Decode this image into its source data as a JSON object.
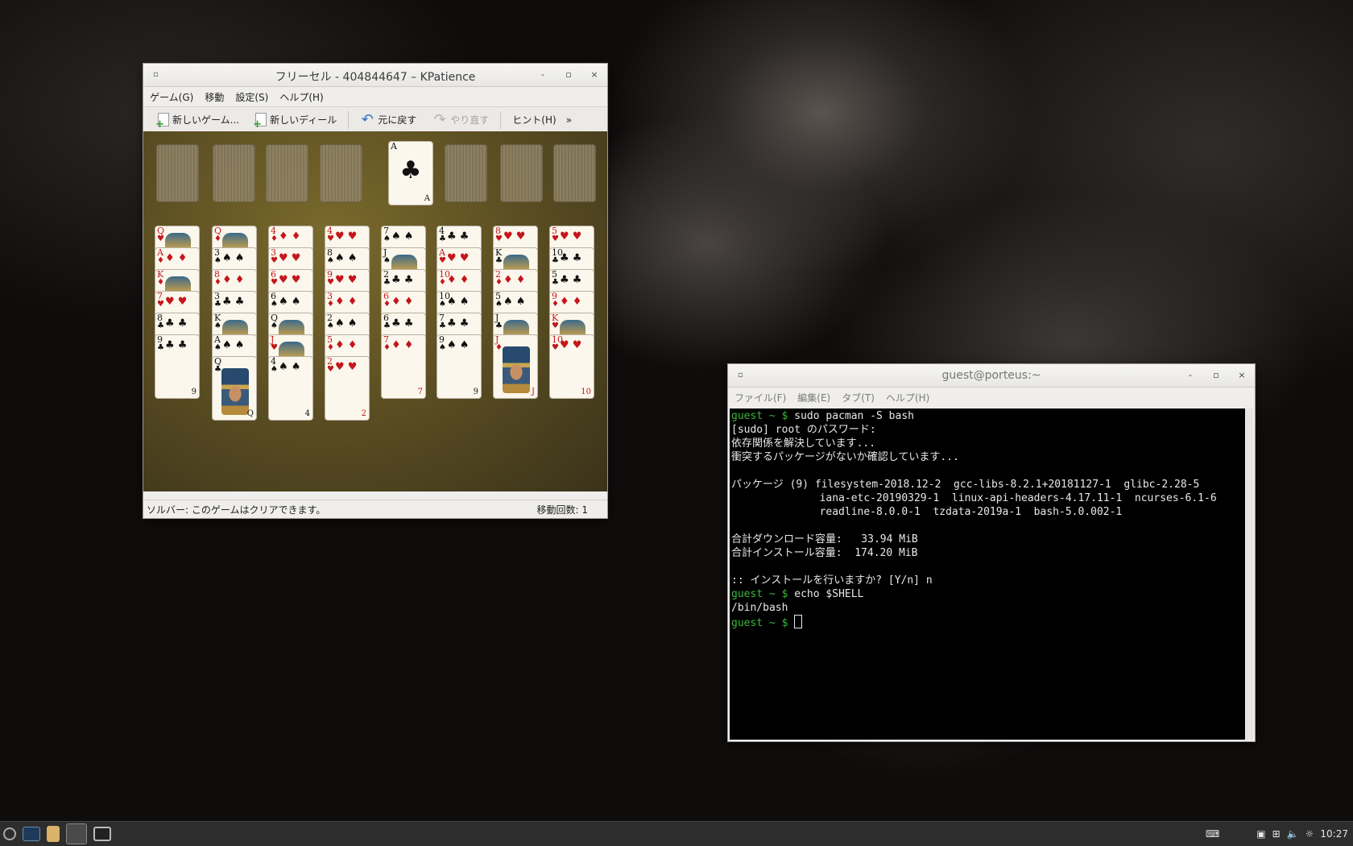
{
  "kpatience": {
    "title": "フリーセル - 404844647 – KPatience",
    "menu": [
      "ゲーム(G)",
      "移動",
      "設定(S)",
      "ヘルプ(H)"
    ],
    "toolbar": {
      "new_game": "新しいゲーム...",
      "new_deal": "新しいディール",
      "undo": "元に戻す",
      "redo": "やり直す",
      "hint": "ヒント(H)",
      "more": "»"
    },
    "foundation_card": {
      "rank": "A",
      "suit": "♣",
      "color": "black"
    },
    "columns": [
      [
        {
          "r": "Q",
          "s": "♥",
          "c": "red",
          "f": 1
        },
        {
          "r": "A",
          "s": "♦",
          "c": "red"
        },
        {
          "r": "K",
          "s": "♦",
          "c": "red",
          "f": 1
        },
        {
          "r": "7",
          "s": "♥",
          "c": "red"
        },
        {
          "r": "8",
          "s": "♣",
          "c": "black"
        },
        {
          "r": "9",
          "s": "♣",
          "c": "black"
        }
      ],
      [
        {
          "r": "Q",
          "s": "♦",
          "c": "red",
          "f": 1
        },
        {
          "r": "3",
          "s": "♠",
          "c": "black"
        },
        {
          "r": "8",
          "s": "♦",
          "c": "red"
        },
        {
          "r": "3",
          "s": "♣",
          "c": "black"
        },
        {
          "r": "K",
          "s": "♠",
          "c": "black",
          "f": 1
        },
        {
          "r": "A",
          "s": "♠",
          "c": "black"
        },
        {
          "r": "Q",
          "s": "♣",
          "c": "black",
          "f": 1
        }
      ],
      [
        {
          "r": "4",
          "s": "♦",
          "c": "red"
        },
        {
          "r": "3",
          "s": "♥",
          "c": "red"
        },
        {
          "r": "6",
          "s": "♥",
          "c": "red"
        },
        {
          "r": "6",
          "s": "♠",
          "c": "black"
        },
        {
          "r": "Q",
          "s": "♠",
          "c": "black",
          "f": 1
        },
        {
          "r": "J",
          "s": "♥",
          "c": "red",
          "f": 1
        },
        {
          "r": "4",
          "s": "♠",
          "c": "black"
        }
      ],
      [
        {
          "r": "4",
          "s": "♥",
          "c": "red"
        },
        {
          "r": "8",
          "s": "♠",
          "c": "black"
        },
        {
          "r": "9",
          "s": "♥",
          "c": "red"
        },
        {
          "r": "3",
          "s": "♦",
          "c": "red"
        },
        {
          "r": "2",
          "s": "♠",
          "c": "black"
        },
        {
          "r": "5",
          "s": "♦",
          "c": "red"
        },
        {
          "r": "2",
          "s": "♥",
          "c": "red"
        }
      ],
      [
        {
          "r": "7",
          "s": "♠",
          "c": "black"
        },
        {
          "r": "J",
          "s": "♠",
          "c": "black",
          "f": 1
        },
        {
          "r": "2",
          "s": "♣",
          "c": "black"
        },
        {
          "r": "6",
          "s": "♦",
          "c": "red"
        },
        {
          "r": "6",
          "s": "♣",
          "c": "black"
        },
        {
          "r": "7",
          "s": "♦",
          "c": "red"
        }
      ],
      [
        {
          "r": "4",
          "s": "♣",
          "c": "black"
        },
        {
          "r": "A",
          "s": "♥",
          "c": "red"
        },
        {
          "r": "10",
          "s": "♦",
          "c": "red"
        },
        {
          "r": "10",
          "s": "♠",
          "c": "black"
        },
        {
          "r": "7",
          "s": "♣",
          "c": "black"
        },
        {
          "r": "9",
          "s": "♠",
          "c": "black"
        }
      ],
      [
        {
          "r": "8",
          "s": "♥",
          "c": "red"
        },
        {
          "r": "K",
          "s": "♣",
          "c": "black",
          "f": 1
        },
        {
          "r": "2",
          "s": "♦",
          "c": "red"
        },
        {
          "r": "5",
          "s": "♠",
          "c": "black"
        },
        {
          "r": "J",
          "s": "♣",
          "c": "black",
          "f": 1
        },
        {
          "r": "J",
          "s": "♦",
          "c": "red",
          "f": 1
        }
      ],
      [
        {
          "r": "5",
          "s": "♥",
          "c": "red"
        },
        {
          "r": "10",
          "s": "♣",
          "c": "black"
        },
        {
          "r": "5",
          "s": "♣",
          "c": "black"
        },
        {
          "r": "9",
          "s": "♦",
          "c": "red"
        },
        {
          "r": "K",
          "s": "♥",
          "c": "red",
          "f": 1
        },
        {
          "r": "10",
          "s": "♥",
          "c": "red"
        }
      ]
    ],
    "status_left": "ソルバー: このゲームはクリアできます。",
    "status_right": "移動回数: 1"
  },
  "terminal": {
    "title": "guest@porteus:~",
    "menu": [
      "ファイル(F)",
      "編集(E)",
      "タブ(T)",
      "ヘルプ(H)"
    ],
    "lines": [
      {
        "prompt": "guest ~ $ ",
        "text": "sudo pacman -S bash"
      },
      {
        "text": "[sudo] root のパスワード:"
      },
      {
        "text": "依存関係を解決しています..."
      },
      {
        "text": "衝突するパッケージがないか確認しています..."
      },
      {
        "text": ""
      },
      {
        "text": "パッケージ (9) filesystem-2018.12-2  gcc-libs-8.2.1+20181127-1  glibc-2.28-5"
      },
      {
        "text": "              iana-etc-20190329-1  linux-api-headers-4.17.11-1  ncurses-6.1-6"
      },
      {
        "text": "              readline-8.0.0-1  tzdata-2019a-1  bash-5.0.002-1"
      },
      {
        "text": ""
      },
      {
        "text": "合計ダウンロード容量:   33.94 MiB"
      },
      {
        "text": "合計インストール容量:  174.20 MiB"
      },
      {
        "text": ""
      },
      {
        "text": ":: インストールを行いますか? [Y/n] n"
      },
      {
        "prompt": "guest ~ $ ",
        "text": "echo $SHELL"
      },
      {
        "text": "/bin/bash"
      },
      {
        "prompt": "guest ~ $ ",
        "text": "",
        "cursor": true
      }
    ]
  },
  "taskbar": {
    "clock": "10:27",
    "icons": [
      "menu-icon",
      "terminal-icon",
      "file-manager-icon",
      "kpatience-icon",
      "desktop-icon"
    ]
  }
}
